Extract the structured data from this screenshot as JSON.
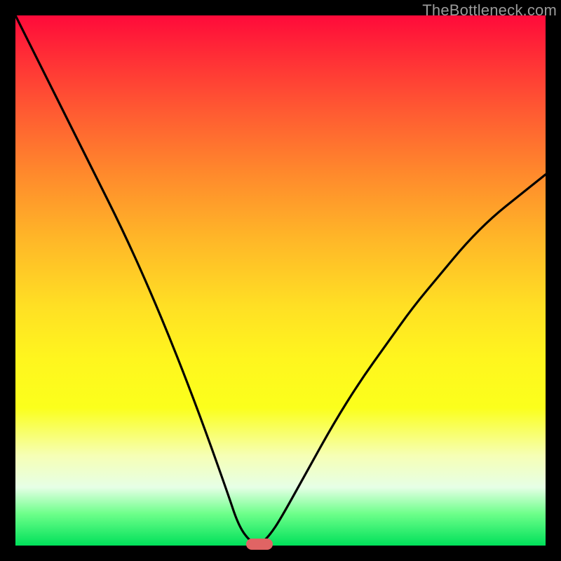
{
  "watermark": "TheBottleneck.com",
  "chart_data": {
    "type": "line",
    "title": "",
    "xlabel": "",
    "ylabel": "",
    "xlim": [
      0,
      100
    ],
    "ylim": [
      0,
      100
    ],
    "grid": false,
    "series": [
      {
        "name": "curve",
        "x": [
          0,
          5,
          10,
          15,
          20,
          25,
          30,
          35,
          40,
          42,
          44,
          46,
          48,
          50,
          55,
          60,
          65,
          70,
          75,
          80,
          85,
          90,
          95,
          100
        ],
        "values": [
          100,
          90,
          80,
          70,
          60,
          49,
          37,
          24,
          10,
          4,
          1,
          0,
          2,
          5,
          14,
          23,
          31,
          38,
          45,
          51,
          57,
          62,
          66,
          70
        ]
      }
    ],
    "marker": {
      "x": 46,
      "y": 0
    },
    "background_gradient": {
      "top": "#ff0a3a",
      "mid": "#fff61e",
      "bottom": "#00e05a"
    },
    "curve_color": "#000000",
    "marker_color": "#e06464"
  }
}
